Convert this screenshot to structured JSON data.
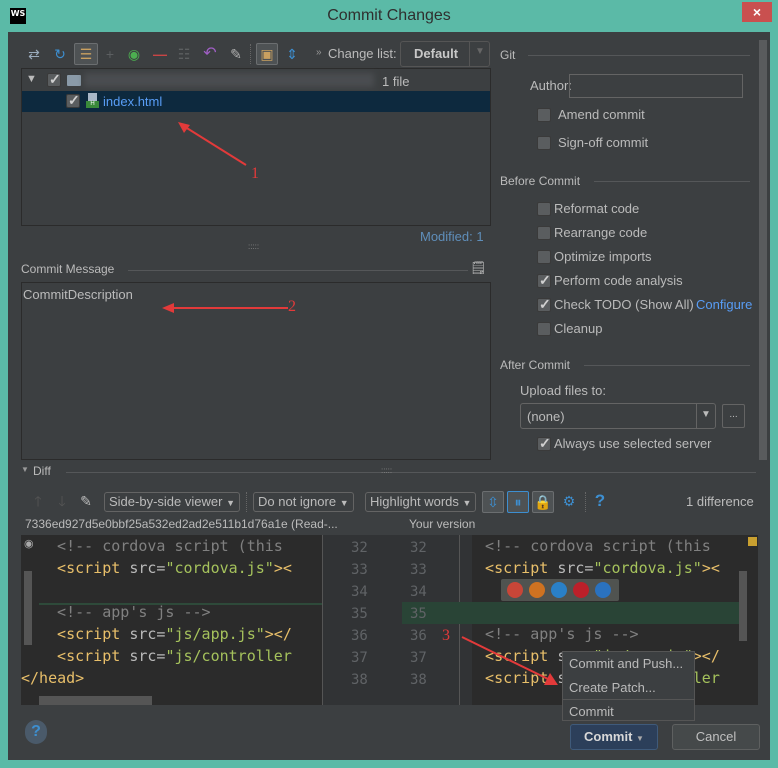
{
  "window": {
    "title": "Commit Changes",
    "app_icon": "WS",
    "close_label": "×"
  },
  "toolbar": {
    "icons": [
      "show-diff-icon",
      "refresh-icon",
      "group-by-icon",
      "add-icon",
      "move-to-changelist-icon",
      "remove-icon",
      "select-items-icon",
      "rollback-icon",
      "edit-source-icon",
      "group-by-directory-icon",
      "expand-all-icon"
    ],
    "changelist_label": "Change list:",
    "changelist_value": "Default"
  },
  "changes": {
    "root_count": "1 file",
    "files": [
      {
        "name": "index.html",
        "checked": true,
        "type": "H"
      }
    ],
    "modified_label": "Modified: 1"
  },
  "commit_message": {
    "label": "Commit Message",
    "value": "CommitDescription"
  },
  "annotations": {
    "a1": "1",
    "a2": "2",
    "a3": "3"
  },
  "git": {
    "section_label": "Git",
    "author_label": "Author:",
    "author_value": "",
    "amend_label": "Amend commit",
    "signoff_label": "Sign-off commit"
  },
  "before_commit": {
    "section_label": "Before Commit",
    "options": [
      {
        "label": "Reformat code",
        "checked": false
      },
      {
        "label": "Rearrange code",
        "checked": false
      },
      {
        "label": "Optimize imports",
        "checked": false
      },
      {
        "label": "Perform code analysis",
        "checked": true
      },
      {
        "label": "Check TODO (Show All)",
        "checked": true
      },
      {
        "label": "Cleanup",
        "checked": false
      }
    ],
    "configure_link": "Configure"
  },
  "after_commit": {
    "section_label": "After Commit",
    "upload_label": "Upload files to:",
    "upload_value": "(none)",
    "browse_label": "...",
    "always_use_label": "Always use selected server",
    "always_use_checked": true
  },
  "diff": {
    "section_label": "Diff",
    "viewer_mode": "Side-by-side viewer",
    "ignore_mode": "Do not ignore",
    "highlight_mode": "Highlight words",
    "difference_count": "1 difference",
    "left_title": "7336ed927d5e0bbf25a532ed2ad2e511b1d76a1e (Read-...",
    "right_title": "Your version",
    "left_lines": [
      32,
      33,
      34,
      35,
      36,
      37,
      38
    ],
    "right_lines": [
      32,
      33,
      34,
      35,
      36,
      37,
      38
    ],
    "left_code": [
      [
        [
          "c-cmt",
          "  <!-- cordova script (this"
        ]
      ],
      [
        [
          "c-tag",
          "  <script "
        ],
        [
          "c-attr",
          "src="
        ],
        [
          "c-str",
          "\"cordova.js\""
        ],
        [
          "c-tag",
          "><"
        ]
      ],
      [],
      [
        [
          "c-cmt",
          "  <!-- app's js -->"
        ]
      ],
      [
        [
          "c-tag",
          "  <script "
        ],
        [
          "c-attr",
          "src="
        ],
        [
          "c-str",
          "\"js/app.js\""
        ],
        [
          "c-tag",
          "></"
        ]
      ],
      [
        [
          "c-tag",
          "  <script "
        ],
        [
          "c-attr",
          "src="
        ],
        [
          "c-str",
          "\"js/controller"
        ]
      ],
      [
        [
          "c-tag",
          "</head>"
        ]
      ]
    ],
    "right_code": [
      [
        [
          "c-cmt",
          "  <!-- cordova script (this"
        ]
      ],
      [
        [
          "c-tag",
          "  <script "
        ],
        [
          "c-attr",
          "src="
        ],
        [
          "c-str",
          "\"cordova.js\""
        ],
        [
          "c-tag",
          "><"
        ]
      ],
      [],
      [],
      [
        [
          "c-cmt",
          "  <!-- app's js -->"
        ]
      ],
      [
        [
          "c-tag",
          "  <script "
        ],
        [
          "c-attr",
          "src="
        ],
        [
          "c-str",
          "\"js/app.js\""
        ],
        [
          "c-tag",
          "></"
        ]
      ],
      [
        [
          "c-tag",
          "  <script "
        ],
        [
          "c-attr",
          "src="
        ],
        [
          "c-str",
          "\"js/controller"
        ]
      ]
    ],
    "browsers": [
      "chrome-icon",
      "firefox-icon",
      "safari-icon",
      "opera-icon",
      "ie-icon"
    ]
  },
  "commit_menu": {
    "items": [
      "Commit and Push...",
      "Create Patch...",
      "Commit"
    ]
  },
  "footer": {
    "help_label": "?",
    "commit_label": "Commit",
    "cancel_label": "Cancel"
  }
}
